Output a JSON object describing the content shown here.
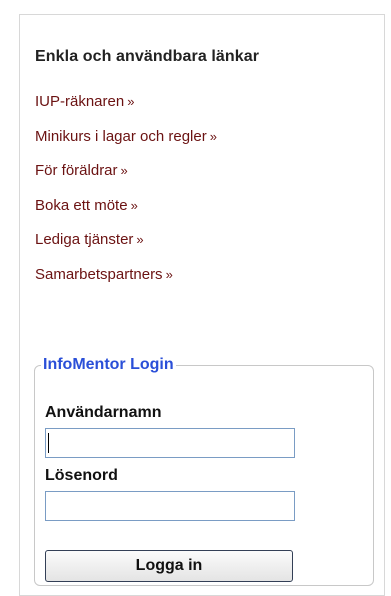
{
  "links_section": {
    "title": "Enkla och användbara länkar",
    "items": [
      {
        "label": "IUP-räknaren",
        "suffix": "»"
      },
      {
        "label": "Minikurs i lagar och regler",
        "suffix": "»"
      },
      {
        "label": "För föräldrar",
        "suffix": "»"
      },
      {
        "label": "Boka ett möte",
        "suffix": "»"
      },
      {
        "label": "Lediga tjänster",
        "suffix": "»"
      },
      {
        "label": "Samarbetspartners",
        "suffix": "»"
      }
    ],
    "link_color": "#6b1212"
  },
  "login": {
    "title": "InfoMentor Login",
    "title_color": "#2a4fd8",
    "username_label": "Användarnamn",
    "username_value": "",
    "password_label": "Lösenord",
    "password_value": "",
    "submit_label": "Logga in"
  }
}
